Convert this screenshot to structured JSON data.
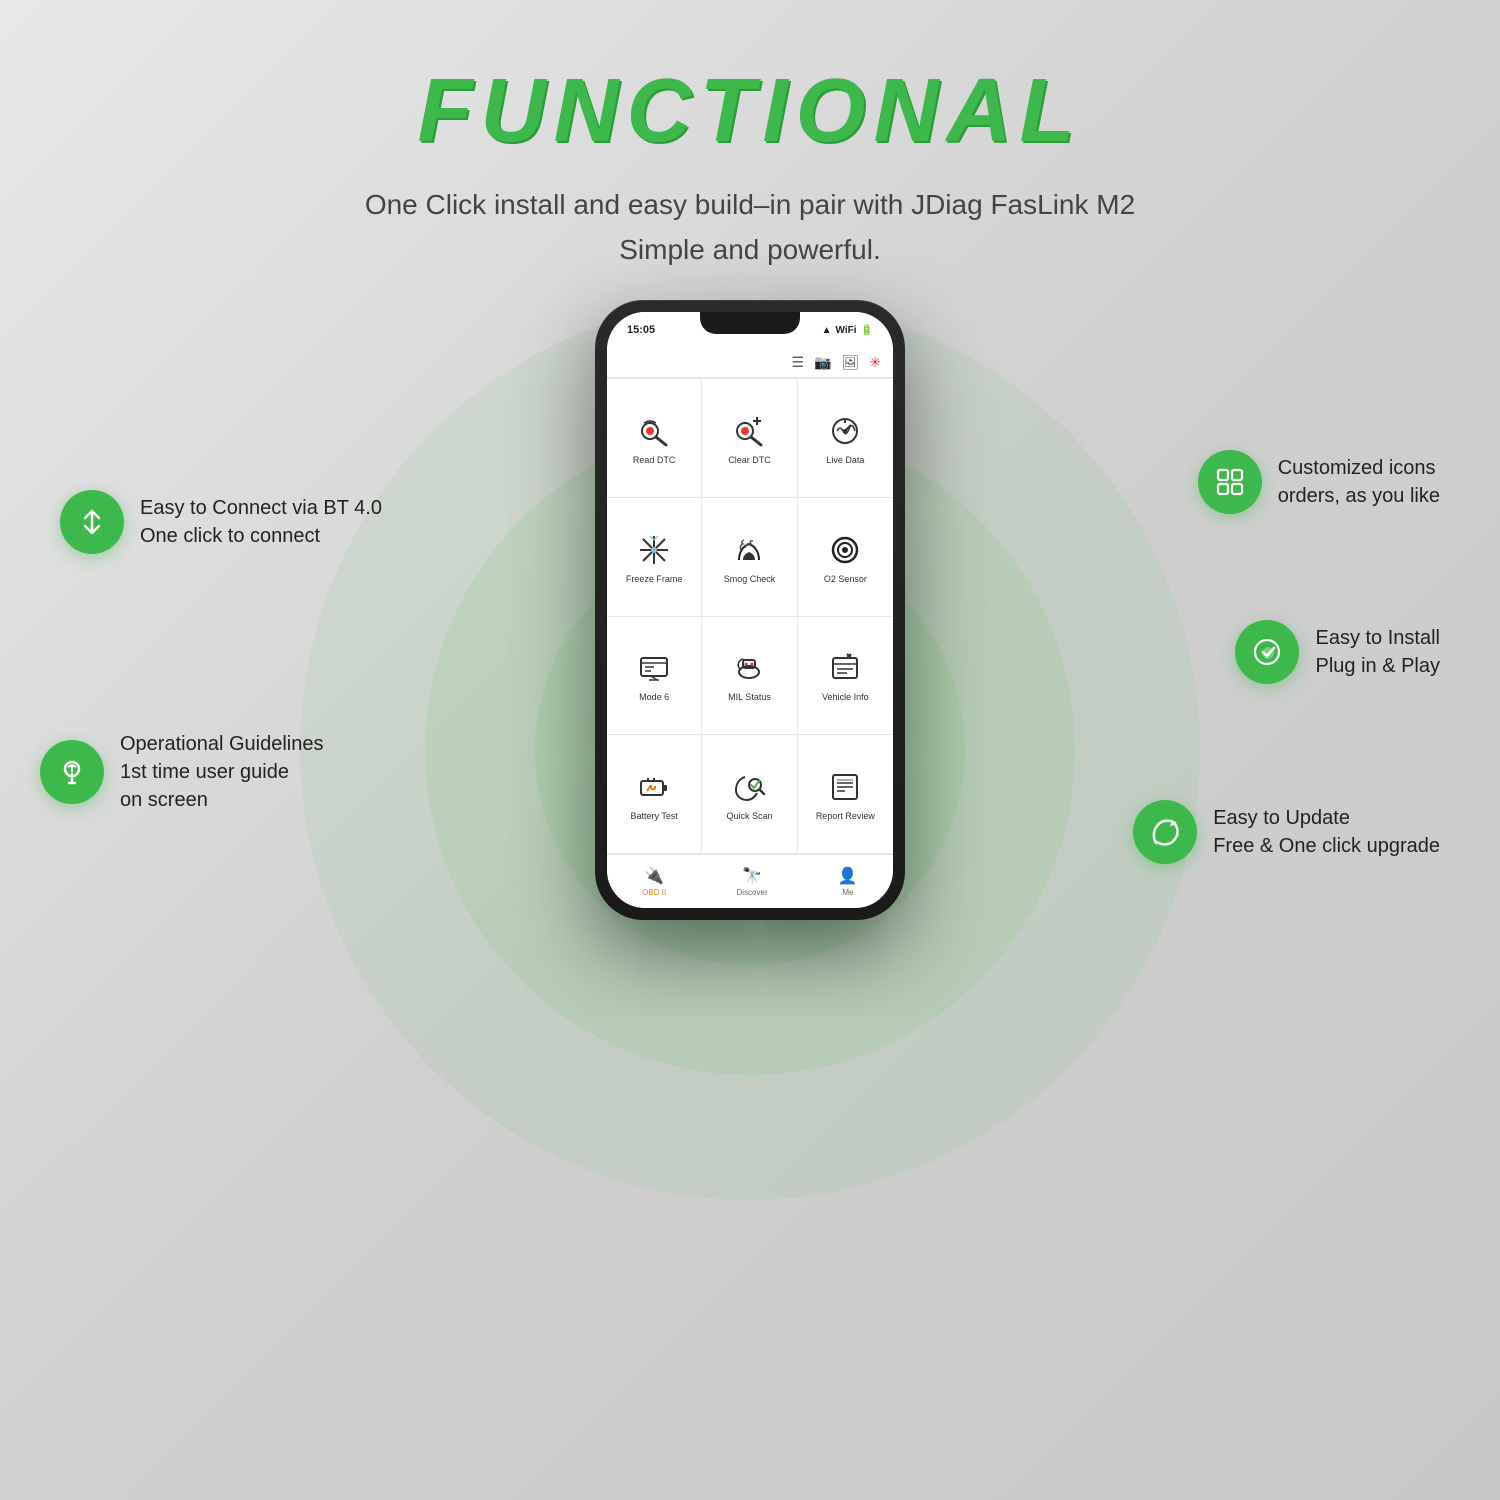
{
  "page": {
    "title": "FUNCTIONAL",
    "subtitle_line1": "One Click install and easy build–in pair with JDiag FasLink M2",
    "subtitle_line2": "Simple and powerful."
  },
  "phone": {
    "status_time": "15:05",
    "status_icons": "▲▲🔋"
  },
  "app_cells": [
    {
      "label": "Read DTC",
      "icon": "read-dtc-icon"
    },
    {
      "label": "Clear DTC",
      "icon": "clear-dtc-icon"
    },
    {
      "label": "Live Data",
      "icon": "live-data-icon"
    },
    {
      "label": "Freeze Frame",
      "icon": "freeze-frame-icon"
    },
    {
      "label": "Smog Check",
      "icon": "smog-check-icon"
    },
    {
      "label": "O2 Sensor",
      "icon": "o2-sensor-icon"
    },
    {
      "label": "Mode 6",
      "icon": "mode6-icon"
    },
    {
      "label": "MIL Status",
      "icon": "mil-status-icon"
    },
    {
      "label": "Vehicle Info",
      "icon": "vehicle-info-icon"
    },
    {
      "label": "Battery Test",
      "icon": "battery-test-icon"
    },
    {
      "label": "Quick Scan",
      "icon": "quick-scan-icon"
    },
    {
      "label": "Report  Review",
      "icon": "report-review-icon"
    }
  ],
  "bottom_nav": [
    {
      "label": "OBD II",
      "active": true
    },
    {
      "label": "Discover",
      "active": false
    },
    {
      "label": "Me",
      "active": false
    }
  ],
  "features": [
    {
      "id": "bt",
      "icon": "bluetooth-icon",
      "text_line1": "Easy to Connect via BT 4.0",
      "text_line2": "One click to connect",
      "position": "left-top"
    },
    {
      "id": "guide",
      "icon": "lightbulb-icon",
      "text_line1": "Operational Guidelines",
      "text_line2": "1st time user guide",
      "text_line3": "on screen",
      "position": "left-bottom"
    },
    {
      "id": "customize",
      "icon": "grid-icon",
      "text_line1": "Customized icons",
      "text_line2": "orders, as you like",
      "position": "right-top"
    },
    {
      "id": "install",
      "icon": "wrench-icon",
      "text_line1": "Easy to Install",
      "text_line2": "Plug in & Play",
      "position": "right-mid"
    },
    {
      "id": "update",
      "icon": "refresh-icon",
      "text_line1": "Easy to Update",
      "text_line2": "Free & One click upgrade",
      "position": "right-bottom"
    }
  ]
}
